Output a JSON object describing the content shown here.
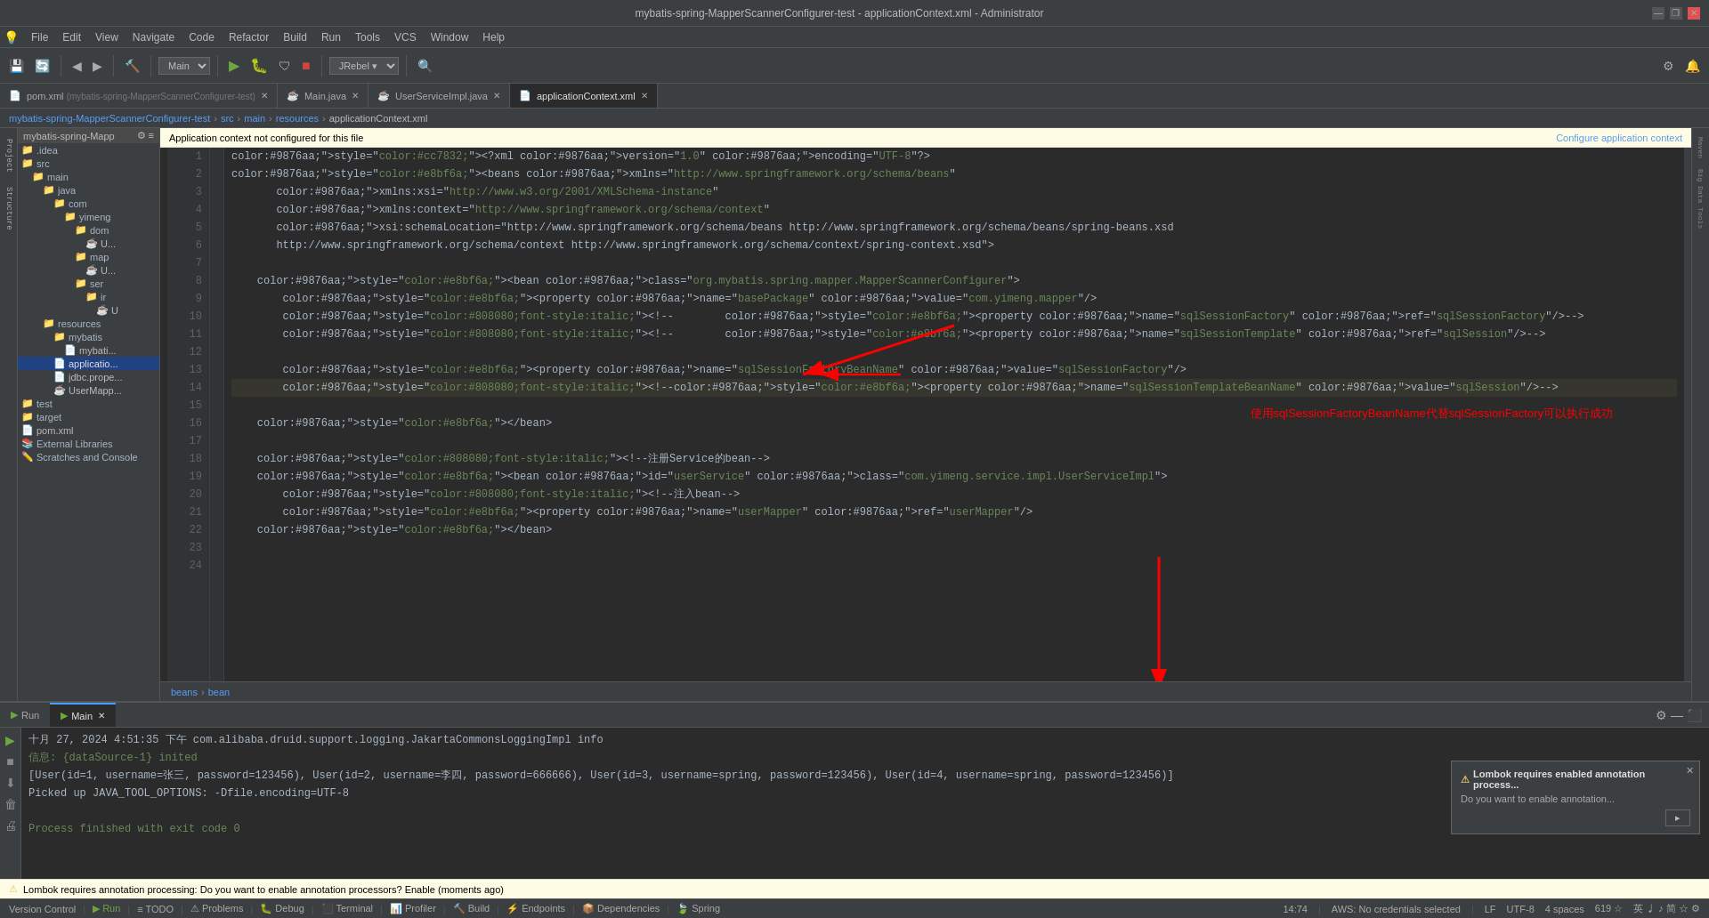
{
  "titleBar": {
    "title": "mybatis-spring-MapperScannerConfigurer-test - applicationContext.xml - Administrator",
    "minBtn": "—",
    "maxBtn": "❐",
    "closeBtn": "✕"
  },
  "menuBar": {
    "items": [
      "File",
      "Edit",
      "View",
      "Navigate",
      "Code",
      "Refactor",
      "Build",
      "Run",
      "Tools",
      "VCS",
      "Window",
      "Help"
    ]
  },
  "breadcrumb": {
    "items": [
      "mybatis-spring-MapperScannerConfigurer-test",
      "src",
      "main",
      "resources",
      "applicationContext.xml"
    ]
  },
  "fileTabs": [
    {
      "name": "pom.xml",
      "subtitle": "(mybatis-spring-MapperScannerConfigurer-test)",
      "active": false
    },
    {
      "name": "Main.java",
      "active": false
    },
    {
      "name": "UserServiceImpl.java",
      "active": false
    },
    {
      "name": "applicationContext.xml",
      "active": true
    }
  ],
  "infoBar": {
    "text": "Application context not configured for this file",
    "linkText": "Configure application context"
  },
  "codeLines": [
    {
      "num": 1,
      "content": "<?xml version=\"1.0\" encoding=\"UTF-8\"?>"
    },
    {
      "num": 2,
      "content": "<beans xmlns=\"http://www.springframework.org/schema/beans\""
    },
    {
      "num": 3,
      "content": "       xmlns:xsi=\"http://www.w3.org/2001/XMLSchema-instance\""
    },
    {
      "num": 4,
      "content": "       xmlns:context=\"http://www.springframework.org/schema/context\""
    },
    {
      "num": 5,
      "content": "       xsi:schemaLocation=\"http://www.springframework.org/schema/beans http://www.springframework.org/schema/beans/spring-beans.xsd"
    },
    {
      "num": 6,
      "content": "       http://www.springframework.org/schema/context http://www.springframework.org/schema/context/spring-context.xsd\">"
    },
    {
      "num": 7,
      "content": ""
    },
    {
      "num": 8,
      "content": "    <bean class=\"org.mybatis.spring.mapper.MapperScannerConfigurer\">"
    },
    {
      "num": 9,
      "content": "        <property name=\"basePackage\" value=\"com.yimeng.mapper\"/>"
    },
    {
      "num": 10,
      "content": "        <!--        <property name=\"sqlSessionFactory\" ref=\"sqlSessionFactory\"/>-->"
    },
    {
      "num": 11,
      "content": "        <!--        <property name=\"sqlSessionTemplate\" ref=\"sqlSession\"/>-->"
    },
    {
      "num": 12,
      "content": ""
    },
    {
      "num": 13,
      "content": "        <property name=\"sqlSessionFactoryBeanName\" value=\"sqlSessionFactory\"/>"
    },
    {
      "num": 14,
      "content": "        <!--<property name=\"sqlSessionTemplateBeanName\" value=\"sqlSession\"/>-->"
    },
    {
      "num": 15,
      "content": ""
    },
    {
      "num": 16,
      "content": "    </bean>"
    },
    {
      "num": 17,
      "content": ""
    },
    {
      "num": 18,
      "content": "    <!--注册Service的bean-->"
    },
    {
      "num": 19,
      "content": "    <bean id=\"userService\" class=\"com.yimeng.service.impl.UserServiceImpl\">"
    },
    {
      "num": 20,
      "content": "        <!--注入bean-->"
    },
    {
      "num": 21,
      "content": "        <property name=\"userMapper\" ref=\"userMapper\"/>"
    },
    {
      "num": 22,
      "content": "    </bean>"
    },
    {
      "num": 23,
      "content": ""
    },
    {
      "num": 24,
      "content": ""
    }
  ],
  "annotationText": "使用sqlSessionFactoryBeanName代替sqlSessionFactory可以执行成功",
  "bottomBreadcrumb": {
    "items": [
      "beans",
      "bean"
    ]
  },
  "sidebar": {
    "projectName": "mybatis-spring-Mapp",
    "tree": [
      {
        "indent": 0,
        "icon": "📁",
        "label": ".idea",
        "type": "folder"
      },
      {
        "indent": 0,
        "icon": "📁",
        "label": "src",
        "type": "folder",
        "expanded": true
      },
      {
        "indent": 1,
        "icon": "📁",
        "label": "main",
        "type": "folder",
        "expanded": true
      },
      {
        "indent": 2,
        "icon": "📁",
        "label": "java",
        "type": "folder",
        "expanded": true
      },
      {
        "indent": 3,
        "icon": "📁",
        "label": "com",
        "type": "folder",
        "expanded": true
      },
      {
        "indent": 4,
        "icon": "📁",
        "label": "yimeng",
        "type": "folder",
        "expanded": true
      },
      {
        "indent": 5,
        "icon": "📁",
        "label": "dom",
        "type": "folder",
        "expanded": true
      },
      {
        "indent": 6,
        "icon": "☕",
        "label": "U...",
        "type": "java"
      },
      {
        "indent": 5,
        "icon": "📁",
        "label": "map",
        "type": "folder",
        "expanded": true
      },
      {
        "indent": 6,
        "icon": "☕",
        "label": "U...",
        "type": "java"
      },
      {
        "indent": 5,
        "icon": "📁",
        "label": "ser",
        "type": "folder",
        "expanded": true
      },
      {
        "indent": 6,
        "icon": "📁",
        "label": "ir",
        "type": "folder",
        "expanded": true
      },
      {
        "indent": 7,
        "icon": "☕",
        "label": "U",
        "type": "java"
      },
      {
        "indent": 2,
        "icon": "📁",
        "label": "resources",
        "type": "folder",
        "expanded": true
      },
      {
        "indent": 3,
        "icon": "📁",
        "label": "mybatis",
        "type": "folder",
        "expanded": true
      },
      {
        "indent": 4,
        "icon": "📄",
        "label": "mybati...",
        "type": "xml"
      },
      {
        "indent": 3,
        "icon": "📄",
        "label": "applicatio...",
        "type": "xml",
        "selected": true
      },
      {
        "indent": 3,
        "icon": "📄",
        "label": "jdbc.prope...",
        "type": "xml"
      },
      {
        "indent": 3,
        "icon": "☕",
        "label": "UserMapp...",
        "type": "java"
      },
      {
        "indent": 0,
        "icon": "📁",
        "label": "test",
        "type": "folder"
      },
      {
        "indent": 0,
        "icon": "📁",
        "label": "target",
        "type": "folder"
      },
      {
        "indent": 0,
        "icon": "📄",
        "label": "pom.xml",
        "type": "xml"
      },
      {
        "indent": 0,
        "icon": "📚",
        "label": "External Libraries",
        "type": "folder"
      },
      {
        "indent": 0,
        "icon": "✏️",
        "label": "Scratches and Console",
        "type": "folder"
      }
    ]
  },
  "bottomPanel": {
    "tabs": [
      {
        "label": "Run",
        "active": false
      },
      {
        "label": "Main",
        "active": true,
        "closeable": true
      }
    ],
    "consoleLines": [
      {
        "text": "十月 27, 2024 4:51:35 下午 com.alibaba.druid.support.logging.JakartaCommonsLoggingImpl info",
        "type": "log"
      },
      {
        "text": "信息: {dataSource-1} inited",
        "type": "green"
      },
      {
        "text": "[User(id=1, username=张三, password=123456), User(id=2, username=李四, password=666666), User(id=3, username=spring, password=123456), User(id=4, username=spring, password=123456)]",
        "type": "log"
      },
      {
        "text": "Picked up JAVA_TOOL_OPTIONS: -Dfile.encoding=UTF-8",
        "type": "log"
      },
      {
        "text": "",
        "type": "log"
      },
      {
        "text": "Process finished with exit code 0",
        "type": "green"
      }
    ]
  },
  "lombokPopup": {
    "title": "Lombok requires enabled annotation process...",
    "message": "Do you want to enable annotation...",
    "btnLabel": "▸"
  },
  "statusBar": {
    "left": "Lombok requires annotation processing: Do you want to enable annotation processors? Enable (moments ago)",
    "right": {
      "line": "14:74",
      "aws": "AWS: No credentials selected",
      "encoding": "UTF-8",
      "lf": "LF",
      "spaces": "4 spaces",
      "chars": "619 ☆",
      "lang": "英 ♩ ♪ 简 ☆ ⚙"
    }
  }
}
